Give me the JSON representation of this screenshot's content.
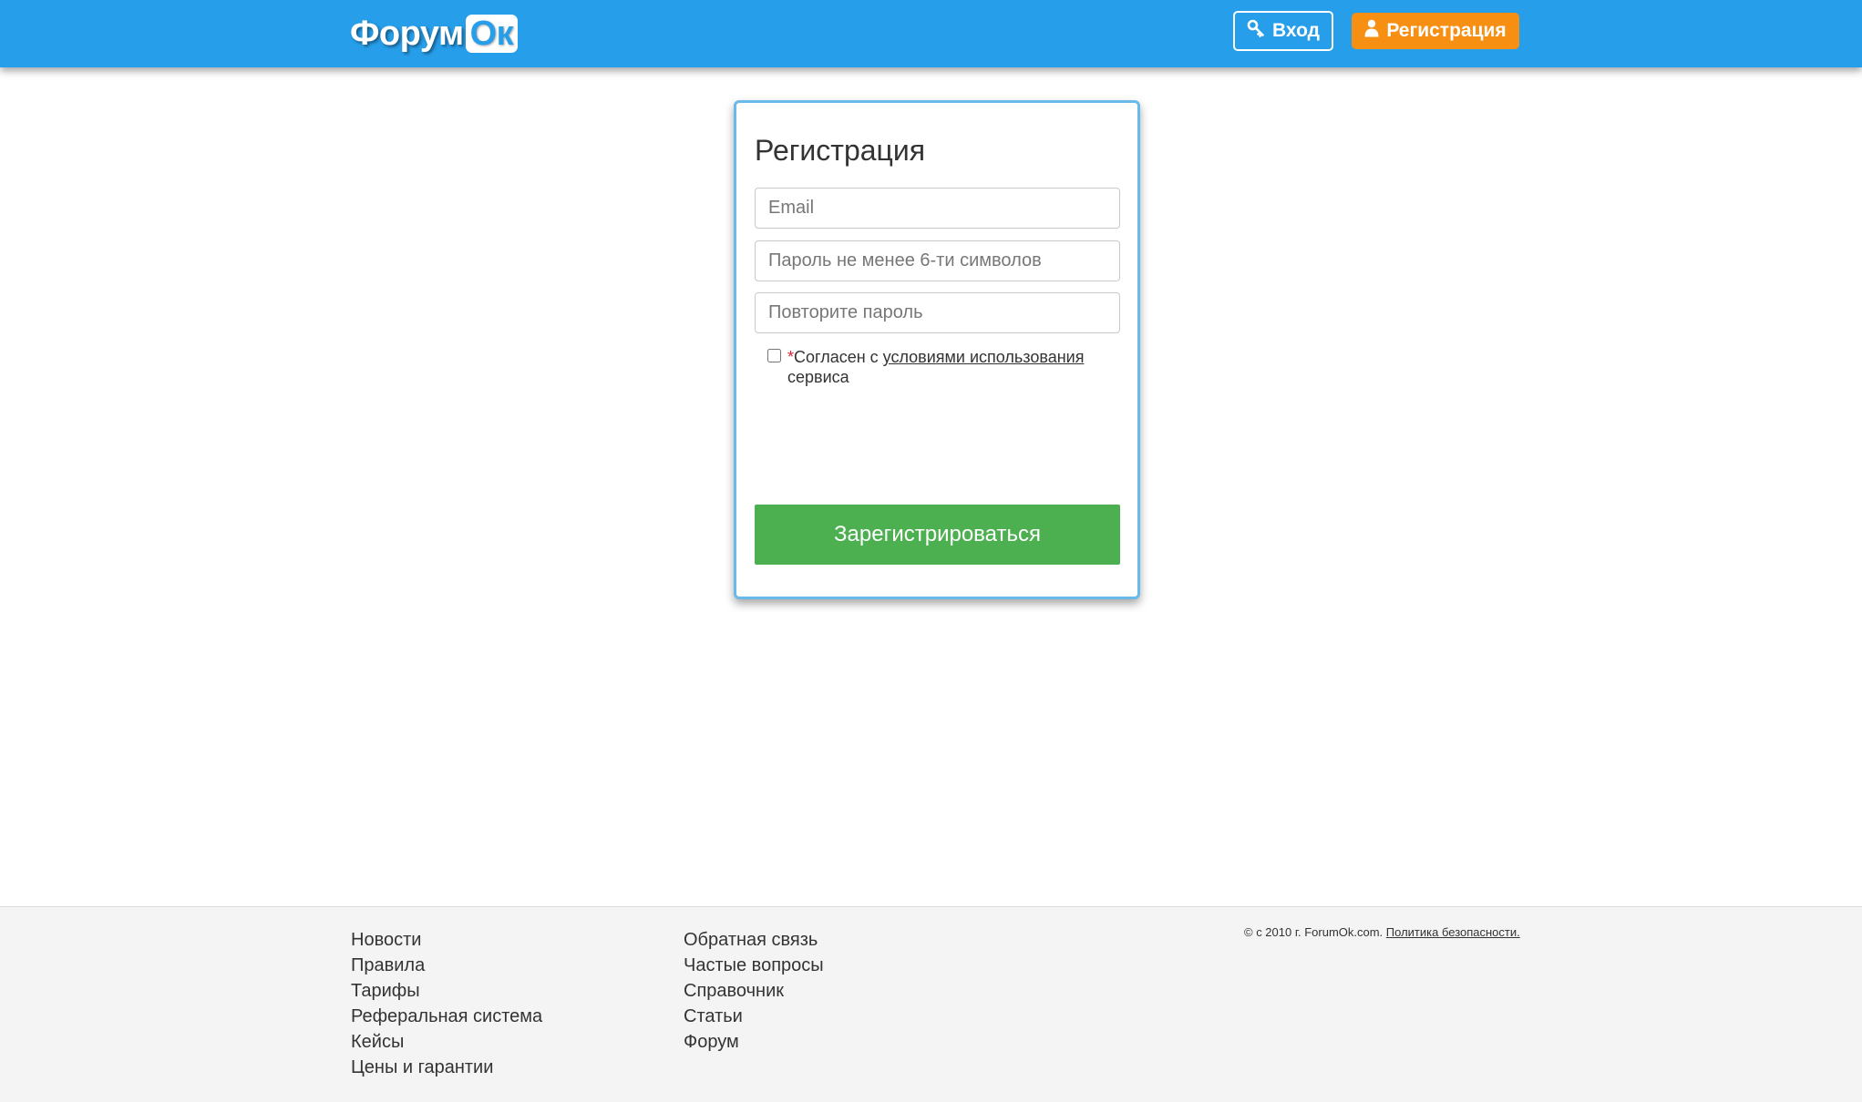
{
  "header": {
    "logo_main": "Форум",
    "logo_ok": "Ок",
    "login_label": "Вход",
    "register_label": "Регистрация"
  },
  "form": {
    "title": "Регистрация",
    "email_placeholder": "Email",
    "password_placeholder": "Пароль не менее 6-ти символов",
    "repeat_placeholder": "Повторите пароль",
    "agree_star": "*",
    "agree_prefix": "Согласен с ",
    "agree_link": "условиями использования",
    "agree_suffix": " сервиса",
    "submit_label": "Зарегистрироваться"
  },
  "footer": {
    "col1": [
      "Новости",
      "Правила",
      "Тарифы",
      "Реферальная система",
      "Кейсы",
      "Цены и гарантии"
    ],
    "col2": [
      "Обратная связь",
      "Частые вопросы",
      "Справочник",
      "Статьи",
      "Форум"
    ],
    "copyright_text": "© с 2010 г. ForumOk.com. ",
    "privacy_link": "Политика безопасности."
  },
  "colors": {
    "header_bg": "#279eea",
    "register_button": "#f68f12",
    "submit_button": "#4caf50",
    "card_border": "#69b9e9",
    "footer_bg": "#f4f4f4"
  },
  "icons": {
    "login": "key-icon",
    "register": "user-icon"
  }
}
